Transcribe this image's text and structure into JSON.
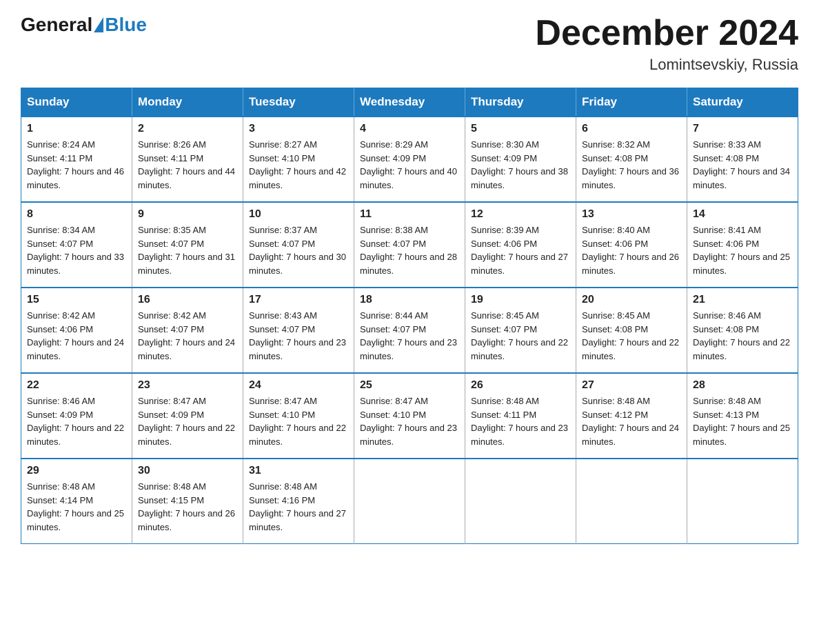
{
  "header": {
    "logo": {
      "part1": "General",
      "part2": "Blue"
    },
    "title": "December 2024",
    "location": "Lomintsevskiy, Russia"
  },
  "days_of_week": [
    "Sunday",
    "Monday",
    "Tuesday",
    "Wednesday",
    "Thursday",
    "Friday",
    "Saturday"
  ],
  "weeks": [
    [
      {
        "day": "1",
        "sunrise": "8:24 AM",
        "sunset": "4:11 PM",
        "daylight": "7 hours and 46 minutes."
      },
      {
        "day": "2",
        "sunrise": "8:26 AM",
        "sunset": "4:11 PM",
        "daylight": "7 hours and 44 minutes."
      },
      {
        "day": "3",
        "sunrise": "8:27 AM",
        "sunset": "4:10 PM",
        "daylight": "7 hours and 42 minutes."
      },
      {
        "day": "4",
        "sunrise": "8:29 AM",
        "sunset": "4:09 PM",
        "daylight": "7 hours and 40 minutes."
      },
      {
        "day": "5",
        "sunrise": "8:30 AM",
        "sunset": "4:09 PM",
        "daylight": "7 hours and 38 minutes."
      },
      {
        "day": "6",
        "sunrise": "8:32 AM",
        "sunset": "4:08 PM",
        "daylight": "7 hours and 36 minutes."
      },
      {
        "day": "7",
        "sunrise": "8:33 AM",
        "sunset": "4:08 PM",
        "daylight": "7 hours and 34 minutes."
      }
    ],
    [
      {
        "day": "8",
        "sunrise": "8:34 AM",
        "sunset": "4:07 PM",
        "daylight": "7 hours and 33 minutes."
      },
      {
        "day": "9",
        "sunrise": "8:35 AM",
        "sunset": "4:07 PM",
        "daylight": "7 hours and 31 minutes."
      },
      {
        "day": "10",
        "sunrise": "8:37 AM",
        "sunset": "4:07 PM",
        "daylight": "7 hours and 30 minutes."
      },
      {
        "day": "11",
        "sunrise": "8:38 AM",
        "sunset": "4:07 PM",
        "daylight": "7 hours and 28 minutes."
      },
      {
        "day": "12",
        "sunrise": "8:39 AM",
        "sunset": "4:06 PM",
        "daylight": "7 hours and 27 minutes."
      },
      {
        "day": "13",
        "sunrise": "8:40 AM",
        "sunset": "4:06 PM",
        "daylight": "7 hours and 26 minutes."
      },
      {
        "day": "14",
        "sunrise": "8:41 AM",
        "sunset": "4:06 PM",
        "daylight": "7 hours and 25 minutes."
      }
    ],
    [
      {
        "day": "15",
        "sunrise": "8:42 AM",
        "sunset": "4:06 PM",
        "daylight": "7 hours and 24 minutes."
      },
      {
        "day": "16",
        "sunrise": "8:42 AM",
        "sunset": "4:07 PM",
        "daylight": "7 hours and 24 minutes."
      },
      {
        "day": "17",
        "sunrise": "8:43 AM",
        "sunset": "4:07 PM",
        "daylight": "7 hours and 23 minutes."
      },
      {
        "day": "18",
        "sunrise": "8:44 AM",
        "sunset": "4:07 PM",
        "daylight": "7 hours and 23 minutes."
      },
      {
        "day": "19",
        "sunrise": "8:45 AM",
        "sunset": "4:07 PM",
        "daylight": "7 hours and 22 minutes."
      },
      {
        "day": "20",
        "sunrise": "8:45 AM",
        "sunset": "4:08 PM",
        "daylight": "7 hours and 22 minutes."
      },
      {
        "day": "21",
        "sunrise": "8:46 AM",
        "sunset": "4:08 PM",
        "daylight": "7 hours and 22 minutes."
      }
    ],
    [
      {
        "day": "22",
        "sunrise": "8:46 AM",
        "sunset": "4:09 PM",
        "daylight": "7 hours and 22 minutes."
      },
      {
        "day": "23",
        "sunrise": "8:47 AM",
        "sunset": "4:09 PM",
        "daylight": "7 hours and 22 minutes."
      },
      {
        "day": "24",
        "sunrise": "8:47 AM",
        "sunset": "4:10 PM",
        "daylight": "7 hours and 22 minutes."
      },
      {
        "day": "25",
        "sunrise": "8:47 AM",
        "sunset": "4:10 PM",
        "daylight": "7 hours and 23 minutes."
      },
      {
        "day": "26",
        "sunrise": "8:48 AM",
        "sunset": "4:11 PM",
        "daylight": "7 hours and 23 minutes."
      },
      {
        "day": "27",
        "sunrise": "8:48 AM",
        "sunset": "4:12 PM",
        "daylight": "7 hours and 24 minutes."
      },
      {
        "day": "28",
        "sunrise": "8:48 AM",
        "sunset": "4:13 PM",
        "daylight": "7 hours and 25 minutes."
      }
    ],
    [
      {
        "day": "29",
        "sunrise": "8:48 AM",
        "sunset": "4:14 PM",
        "daylight": "7 hours and 25 minutes."
      },
      {
        "day": "30",
        "sunrise": "8:48 AM",
        "sunset": "4:15 PM",
        "daylight": "7 hours and 26 minutes."
      },
      {
        "day": "31",
        "sunrise": "8:48 AM",
        "sunset": "4:16 PM",
        "daylight": "7 hours and 27 minutes."
      },
      null,
      null,
      null,
      null
    ]
  ]
}
